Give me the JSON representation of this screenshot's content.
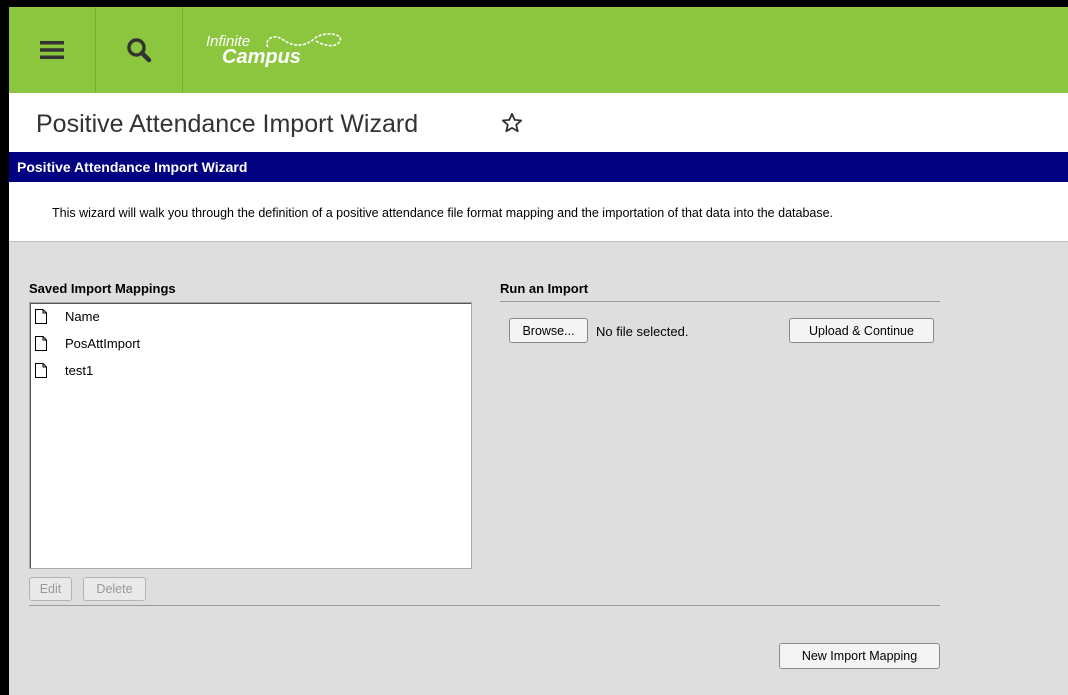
{
  "header": {
    "logo_line1": "Infinite",
    "logo_line2": "Campus"
  },
  "page": {
    "title": "Positive Attendance Import Wizard"
  },
  "wizard": {
    "header": "Positive Attendance Import Wizard",
    "description": "This wizard will walk you through the definition of a positive attendance file format mapping and the importation of that data into the database."
  },
  "saved_mappings": {
    "label": "Saved Import Mappings",
    "items": [
      "Name",
      "PosAttImport",
      "test1"
    ],
    "edit_label": "Edit",
    "delete_label": "Delete",
    "new_label": "New Import Mapping"
  },
  "run_import": {
    "label": "Run an Import",
    "browse_label": "Browse...",
    "file_status": "No file selected.",
    "upload_label": "Upload & Continue"
  },
  "colors": {
    "brand_green": "#8cc63f",
    "wizard_header": "#000080",
    "panel_bg": "#dedede"
  },
  "icons": [
    "menu-icon",
    "search-icon",
    "star-icon",
    "document-icon"
  ]
}
